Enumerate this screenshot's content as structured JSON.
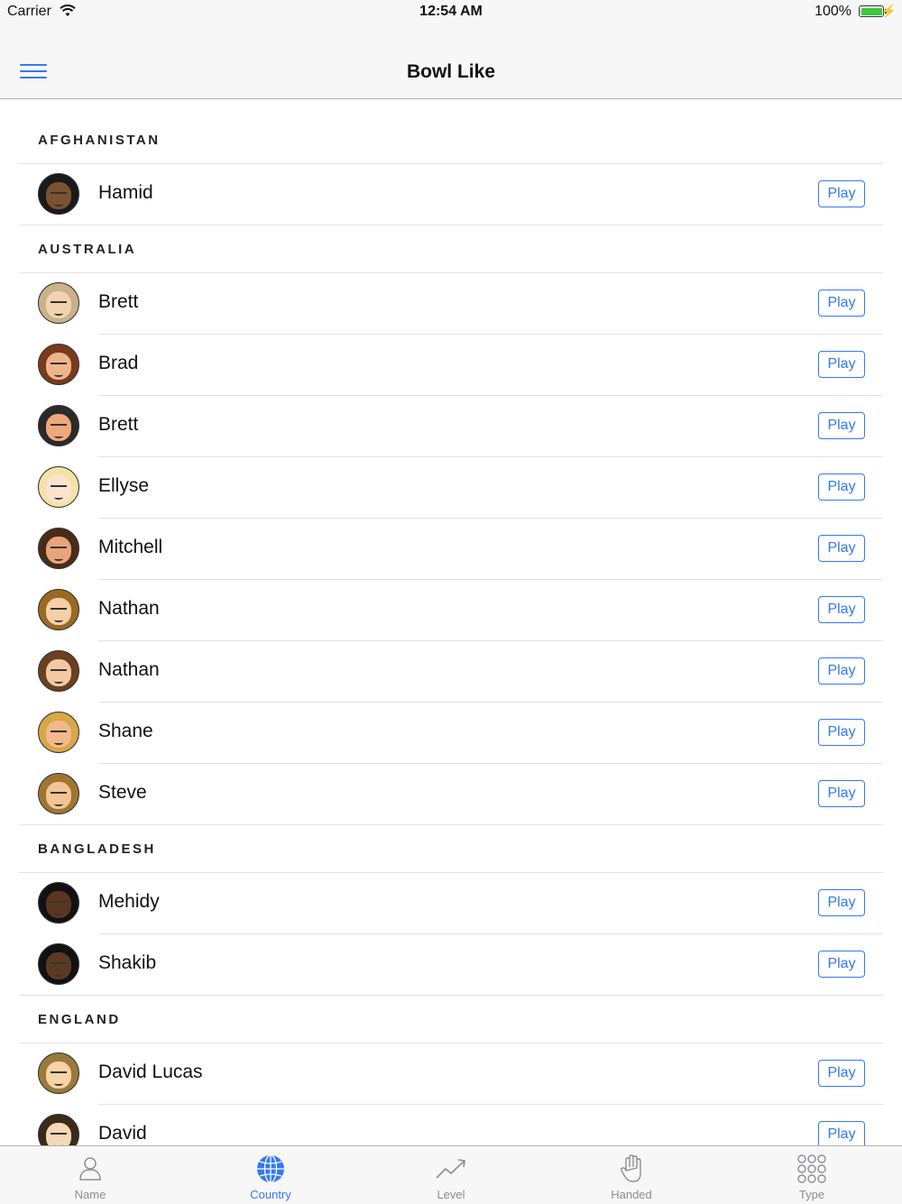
{
  "status_bar": {
    "carrier": "Carrier",
    "time": "12:54 AM",
    "battery": "100%"
  },
  "nav": {
    "title": "Bowl Like"
  },
  "sections": [
    {
      "header": "AFGHANISTAN",
      "players": [
        {
          "name": "Hamid",
          "play": "Play",
          "skin": "#7a5230",
          "hair": "#1a1a1a"
        }
      ]
    },
    {
      "header": "AUSTRALIA",
      "players": [
        {
          "name": "Brett",
          "play": "Play",
          "skin": "#f1d3b0",
          "hair": "#c9b28a"
        },
        {
          "name": "Brad",
          "play": "Play",
          "skin": "#f0b48a",
          "hair": "#7a3a1c"
        },
        {
          "name": "Brett",
          "play": "Play",
          "skin": "#f0a878",
          "hair": "#2a2a2a"
        },
        {
          "name": "Ellyse",
          "play": "Play",
          "skin": "#fbe3cf",
          "hair": "#f4e3a8"
        },
        {
          "name": "Mitchell",
          "play": "Play",
          "skin": "#e8a57a",
          "hair": "#4a2b18"
        },
        {
          "name": "Nathan",
          "play": "Play",
          "skin": "#f5cfa8",
          "hair": "#9a6a22"
        },
        {
          "name": "Nathan",
          "play": "Play",
          "skin": "#f3c9a4",
          "hair": "#6a4020"
        },
        {
          "name": "Shane",
          "play": "Play",
          "skin": "#f2b98c",
          "hair": "#d9a648"
        },
        {
          "name": "Steve",
          "play": "Play",
          "skin": "#f3c594",
          "hair": "#a07530"
        }
      ]
    },
    {
      "header": "BANGLADESH",
      "players": [
        {
          "name": "Mehidy",
          "play": "Play",
          "skin": "#5a3620",
          "hair": "#111111"
        },
        {
          "name": "Shakib",
          "play": "Play",
          "skin": "#5c3a22",
          "hair": "#111111"
        }
      ]
    },
    {
      "header": "ENGLAND",
      "players": [
        {
          "name": "David Lucas",
          "play": "Play",
          "skin": "#f5d3a6",
          "hair": "#9a7a3a"
        },
        {
          "name": "David",
          "play": "Play",
          "skin": "#f5d8b4",
          "hair": "#3a2a1a"
        }
      ]
    }
  ],
  "tabs": [
    {
      "label": "Name",
      "icon": "person-icon"
    },
    {
      "label": "Country",
      "icon": "globe-icon",
      "active": true
    },
    {
      "label": "Level",
      "icon": "trend-icon"
    },
    {
      "label": "Handed",
      "icon": "hand-icon"
    },
    {
      "label": "Type",
      "icon": "grid-icon"
    }
  ],
  "colors": {
    "accent": "#3478f6",
    "inactive": "#8e8e93",
    "separator": "#e3e3e3"
  }
}
